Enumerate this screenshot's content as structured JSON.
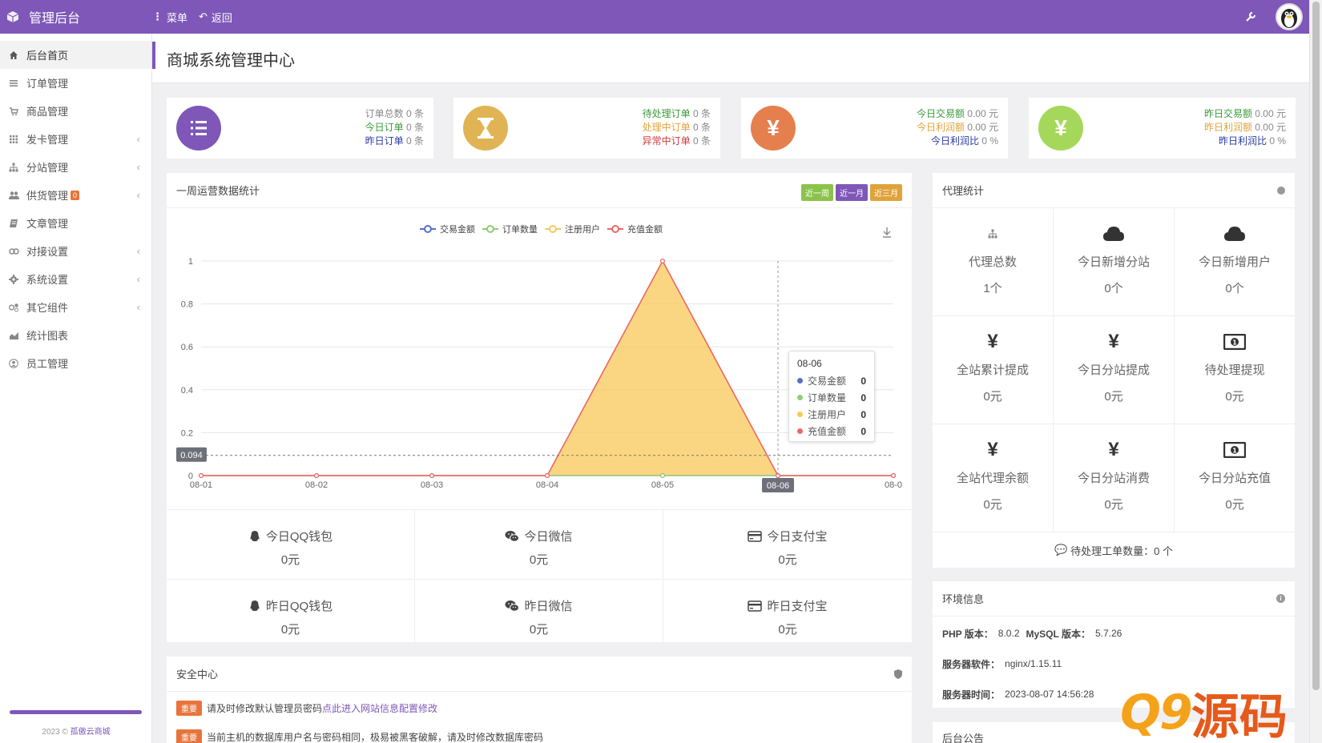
{
  "topbar": {
    "title": "管理后台",
    "menu_label": "菜单",
    "back_label": "返回"
  },
  "sidebar": {
    "items": [
      {
        "label": "后台首页",
        "icon": "home-icon"
      },
      {
        "label": "订单管理",
        "icon": "list-icon"
      },
      {
        "label": "商品管理",
        "icon": "goods-icon"
      },
      {
        "label": "发卡管理",
        "icon": "grid-icon"
      },
      {
        "label": "分站管理",
        "icon": "sitemap-icon"
      },
      {
        "label": "供货管理",
        "icon": "users-icon",
        "badge": "0"
      },
      {
        "label": "文章管理",
        "icon": "article-icon"
      },
      {
        "label": "对接设置",
        "icon": "link-icon"
      },
      {
        "label": "系统设置",
        "icon": "gear-icon"
      },
      {
        "label": "其它组件",
        "icon": "puzzle-icon"
      },
      {
        "label": "统计图表",
        "icon": "chart-icon"
      },
      {
        "label": "员工管理",
        "icon": "user-icon"
      }
    ],
    "footer_year": "2023 ©",
    "footer_link": "孤傲云商城"
  },
  "page": {
    "title": "商城系统管理中心"
  },
  "stats": [
    {
      "lines": [
        {
          "label": "订单总数",
          "value": "0 条",
          "color": "#888888"
        },
        {
          "label": "今日订单",
          "value": "0 条",
          "color": "#3a9a3a"
        },
        {
          "label": "昨日订单",
          "value": "0 条",
          "color": "#2a3aa5"
        }
      ],
      "color": "#7e57b8"
    },
    {
      "lines": [
        {
          "label": "待处理订单",
          "value": "0 条",
          "color": "#3a9a3a"
        },
        {
          "label": "处理中订单",
          "value": "0 条",
          "color": "#e0a33a"
        },
        {
          "label": "异常中订单",
          "value": "0 条",
          "color": "#d23a3a"
        }
      ],
      "color": "#e0b454"
    },
    {
      "lines": [
        {
          "label": "今日交易额",
          "value": "0.00 元",
          "color": "#3a9a3a"
        },
        {
          "label": "今日利润额",
          "value": "0.00 元",
          "color": "#e0a33a"
        },
        {
          "label": "今日利润比",
          "value": "0 %",
          "color": "#2a3aa5"
        }
      ],
      "color": "#e57f4e"
    },
    {
      "lines": [
        {
          "label": "昨日交易额",
          "value": "0.00 元",
          "color": "#3a9a3a"
        },
        {
          "label": "昨日利润额",
          "value": "0.00 元",
          "color": "#e0a33a"
        },
        {
          "label": "昨日利润比",
          "value": "0 %",
          "color": "#2a3aa5"
        }
      ],
      "color": "#a5d85a"
    }
  ],
  "weekly": {
    "title": "一周运营数据统计",
    "range_buttons": [
      "近一周",
      "近一月",
      "近三月"
    ]
  },
  "chart_data": {
    "type": "area",
    "x": [
      "08-01",
      "08-02",
      "08-03",
      "08-04",
      "08-05",
      "08-06",
      "08-0"
    ],
    "series": [
      {
        "name": "交易金额",
        "values": [
          0,
          0,
          0,
          0,
          0,
          0,
          0
        ],
        "color": "#5470c6"
      },
      {
        "name": "订单数量",
        "values": [
          0,
          0,
          0,
          0,
          0,
          0,
          0
        ],
        "color": "#91cc75"
      },
      {
        "name": "注册用户",
        "values": [
          0,
          0,
          0,
          0,
          1,
          0,
          0
        ],
        "color": "#fac858"
      },
      {
        "name": "充值金额",
        "values": [
          0,
          0,
          0,
          0,
          1,
          0,
          0
        ],
        "color": "#ee6666"
      }
    ],
    "y_ticks": [
      "0",
      "0.2",
      "0.4",
      "0.6",
      "0.8",
      "1"
    ],
    "ylim": [
      0,
      1
    ],
    "cursor_y_label": "0.094",
    "cursor_y_value": 0.094,
    "tooltip": {
      "date": "08-06",
      "rows": [
        {
          "name": "交易金额",
          "value": "0",
          "color": "#5470c6"
        },
        {
          "name": "订单数量",
          "value": "0",
          "color": "#91cc75"
        },
        {
          "name": "注册用户",
          "value": "0",
          "color": "#fac858"
        },
        {
          "name": "充值金额",
          "value": "0",
          "color": "#ee6666"
        }
      ]
    }
  },
  "payments": [
    {
      "label": "今日QQ钱包",
      "value": "0元",
      "icon": "qq-icon"
    },
    {
      "label": "今日微信",
      "value": "0元",
      "icon": "wechat-icon"
    },
    {
      "label": "今日支付宝",
      "value": "0元",
      "icon": "card-icon"
    },
    {
      "label": "昨日QQ钱包",
      "value": "0元",
      "icon": "qq-icon"
    },
    {
      "label": "昨日微信",
      "value": "0元",
      "icon": "wechat-icon"
    },
    {
      "label": "昨日支付宝",
      "value": "0元",
      "icon": "card-icon"
    }
  ],
  "agent": {
    "title": "代理统计",
    "cells": [
      {
        "label": "代理总数",
        "value": "1个",
        "icon": "sitemap-icon"
      },
      {
        "label": "今日新增分站",
        "value": "0个",
        "icon": "cloud-icon"
      },
      {
        "label": "今日新增用户",
        "value": "0个",
        "icon": "cloud-icon"
      },
      {
        "label": "全站累计提成",
        "value": "0元",
        "icon": "yen-icon"
      },
      {
        "label": "今日分站提成",
        "value": "0元",
        "icon": "yen-icon"
      },
      {
        "label": "待处理提现",
        "value": "0元",
        "icon": "money-icon"
      },
      {
        "label": "全站代理余额",
        "value": "0元",
        "icon": "yen-icon"
      },
      {
        "label": "今日分站消费",
        "value": "0元",
        "icon": "yen-icon"
      },
      {
        "label": "今日分站充值",
        "value": "0元",
        "icon": "money-icon"
      }
    ],
    "footer": "待处理工单数量：0 个"
  },
  "env": {
    "title": "环境信息",
    "php_label": "PHP 版本：",
    "php_value": "8.0.2",
    "mysql_label": "MySQL 版本：",
    "mysql_value": "5.7.26",
    "server_label": "服务器软件：",
    "server_value": "nginx/1.15.11",
    "time_label": "服务器时间：",
    "time_value": "2023-08-07 14:56:28"
  },
  "notice": {
    "title": "后台公告"
  },
  "security": {
    "title": "安全中心",
    "rows": [
      {
        "tag": "重要",
        "text": "请及时修改默认管理员密码 ",
        "link": "点此进入网站信息配置修改"
      },
      {
        "tag": "重要",
        "text": "当前主机的数据库用户名与密码相同，极易被黑客破解，请及时修改数据库密码",
        "link": ""
      }
    ]
  },
  "watermark": {
    "num": "Q9",
    "text": "源码"
  }
}
